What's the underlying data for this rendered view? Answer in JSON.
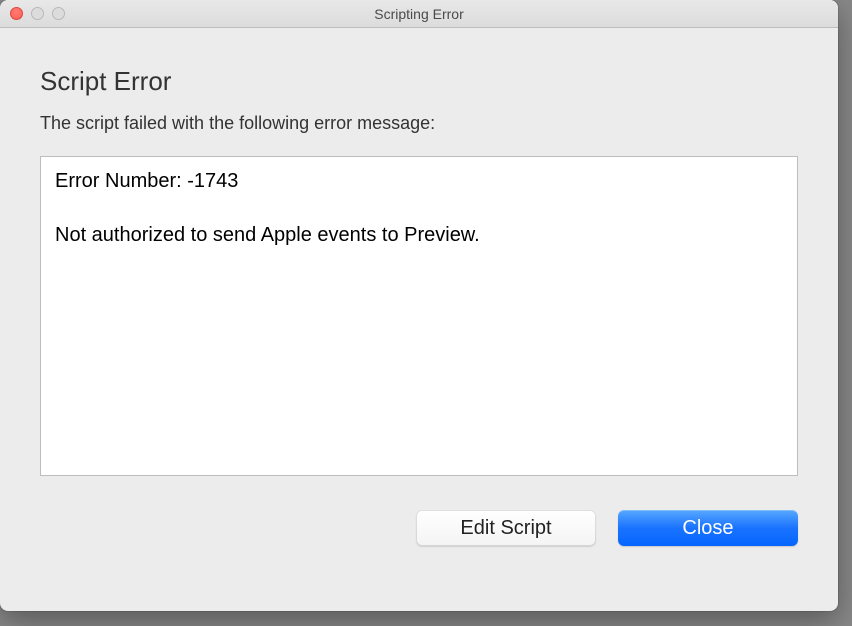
{
  "window": {
    "title": "Scripting Error"
  },
  "dialog": {
    "heading": "Script Error",
    "message": "The script failed with the following error message:",
    "error_number_label": "Error Number: -1743",
    "error_body": "Not authorized to send Apple events to Preview."
  },
  "buttons": {
    "edit_script": "Edit Script",
    "close": "Close"
  }
}
